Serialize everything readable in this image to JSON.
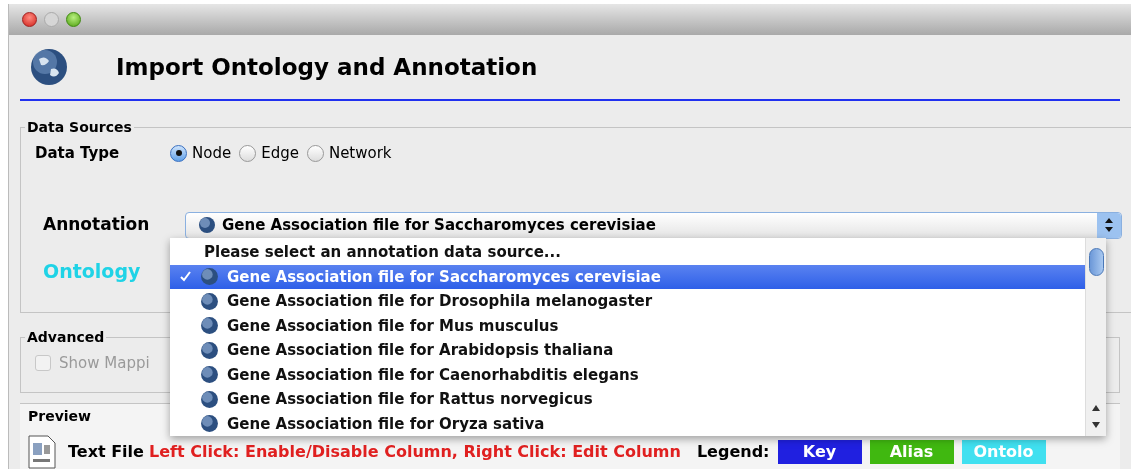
{
  "header": {
    "title": "Import Ontology and Annotation"
  },
  "data_sources": {
    "label": "Data Sources",
    "data_type": {
      "label": "Data Type",
      "options": [
        {
          "label": "Node",
          "selected": true
        },
        {
          "label": "Edge",
          "selected": false
        },
        {
          "label": "Network",
          "selected": false
        }
      ]
    },
    "annotation": {
      "label": "Annotation",
      "value": "Gene Association file for Saccharomyces cerevisiae"
    },
    "ontology": {
      "label": "Ontology"
    }
  },
  "annotation_popup": {
    "items": [
      {
        "kind": "prompt",
        "label": "Please select an annotation data source...",
        "selected": false
      },
      {
        "kind": "source",
        "label": "Gene Association file for Saccharomyces cerevisiae",
        "selected": true
      },
      {
        "kind": "source",
        "label": "Gene Association file for Drosophila melanogaster",
        "selected": false
      },
      {
        "kind": "source",
        "label": "Gene Association file for Mus musculus",
        "selected": false
      },
      {
        "kind": "source",
        "label": "Gene Association file for Arabidopsis thaliana",
        "selected": false
      },
      {
        "kind": "source",
        "label": "Gene Association file for Caenorhabditis elegans",
        "selected": false
      },
      {
        "kind": "source",
        "label": "Gene Association file for Rattus norvegicus",
        "selected": false
      },
      {
        "kind": "source",
        "label": "Gene Association file for Oryza sativa",
        "selected": false
      }
    ]
  },
  "advanced": {
    "label": "Advanced",
    "show_mapping": {
      "label": "Show Mappi",
      "checked": false,
      "disabled": true
    }
  },
  "preview": {
    "label": "Preview",
    "file_type": "Text File",
    "hint": "Left Click: Enable/Disable Column, Right Click: Edit Column",
    "legend_label": "Legend:",
    "legend": [
      {
        "label": "Key",
        "color": "#2020e0"
      },
      {
        "label": "Alias",
        "color": "#40b810"
      },
      {
        "label": "Ontolo",
        "color": "#40e0f0"
      }
    ]
  }
}
